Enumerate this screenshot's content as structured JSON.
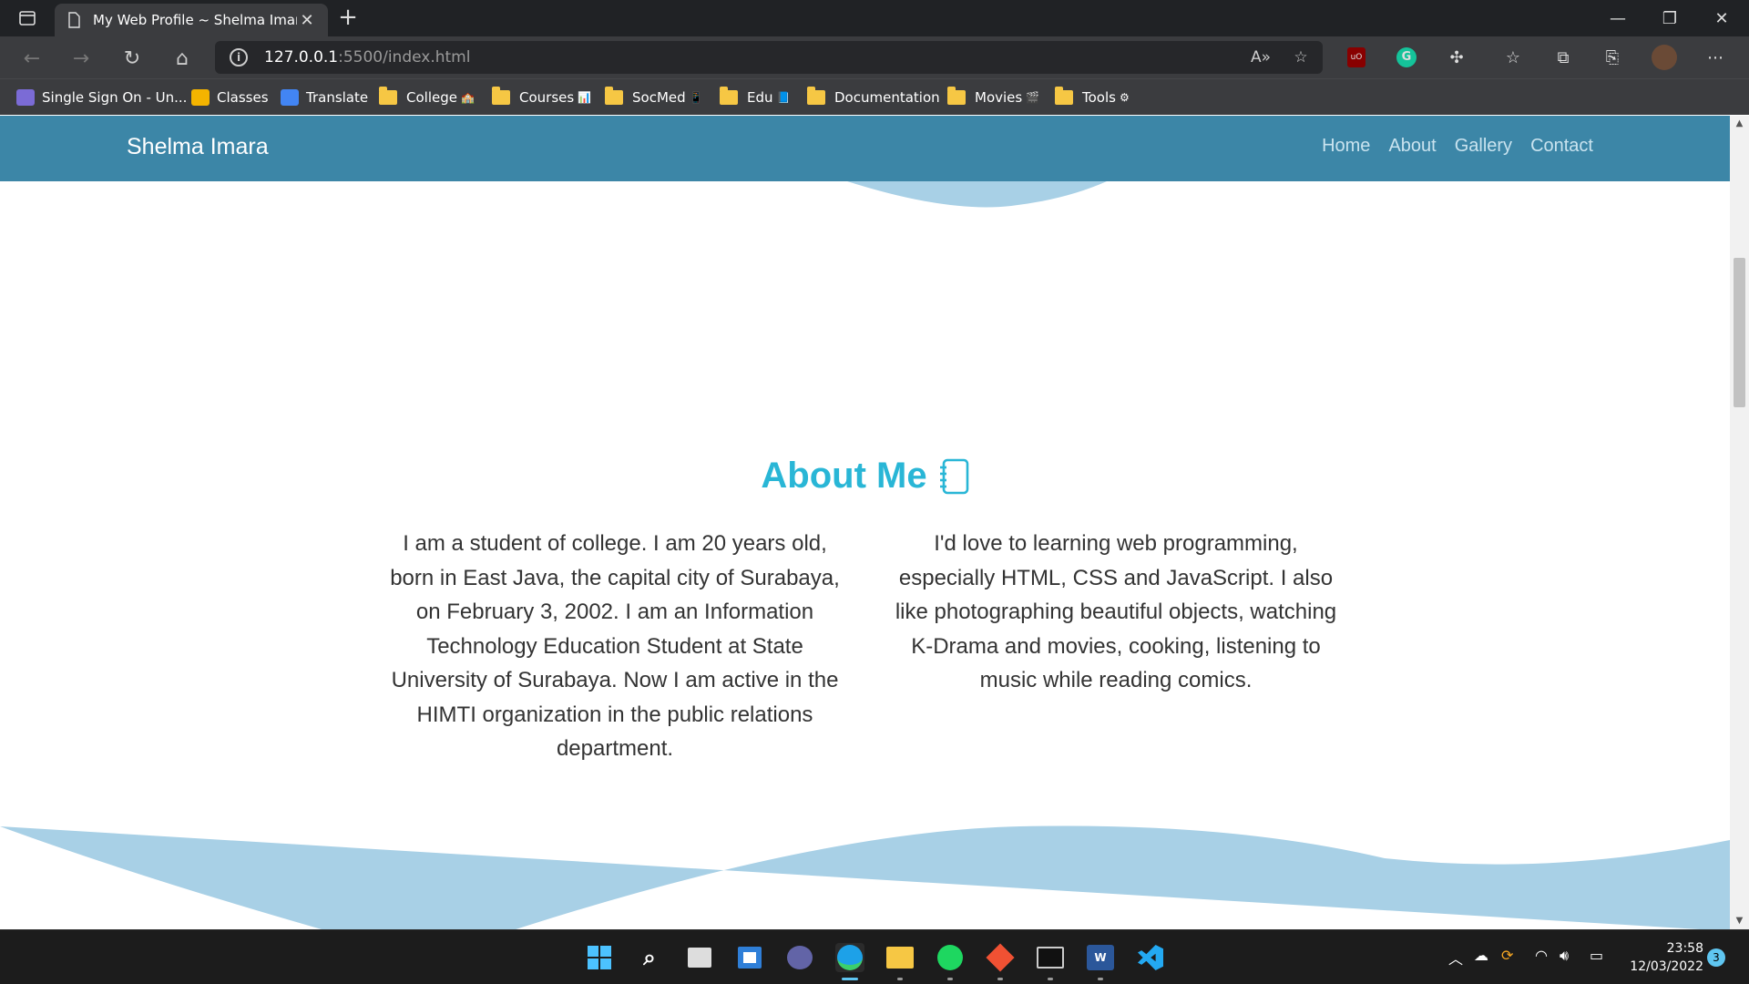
{
  "browser": {
    "tab_title": "My Web Profile ~ Shelma Imara",
    "url_host": "127.0.0.1",
    "url_rest": ":5500/index.html",
    "bookmarks": [
      {
        "label": "Single Sign On - Un...",
        "type": "site"
      },
      {
        "label": "Classes",
        "type": "site"
      },
      {
        "label": "Translate",
        "type": "site"
      },
      {
        "label": "College",
        "type": "folder",
        "emoji": "🏫"
      },
      {
        "label": "Courses",
        "type": "folder",
        "emoji": "📊"
      },
      {
        "label": "SocMed",
        "type": "folder",
        "emoji": "📱"
      },
      {
        "label": "Edu",
        "type": "folder",
        "emoji": "📘"
      },
      {
        "label": "Documentation",
        "type": "folder",
        "emoji": ""
      },
      {
        "label": "Movies",
        "type": "folder",
        "emoji": "🎬"
      },
      {
        "label": "Tools",
        "type": "folder",
        "emoji": "⚙"
      }
    ]
  },
  "site": {
    "brand": "Shelma Imara",
    "nav": [
      "Home",
      "About",
      "Gallery",
      "Contact"
    ],
    "about_title": "About Me",
    "about_left": "I am a student of college. I am 20 years old, born in East Java, the capital city of Surabaya, on February 3, 2002. I am an Information Technology Education Student at State University of Surabaya. Now I am active in the HIMTI organization in the public relations department.",
    "about_right": "I'd love to learning web programming, especially HTML, CSS and JavaScript. I also like photographing beautiful objects, watching K-Drama and movies, cooking, listening to music while reading comics.",
    "colors": {
      "nav": "#3c86a7",
      "wave": "#a8d0e6",
      "accent": "#29b6d6"
    }
  },
  "taskbar": {
    "time": "23:58",
    "date": "12/03/2022",
    "notifications": "3",
    "apps": [
      "start-icon",
      "search-icon",
      "task-view-icon",
      "widgets-icon",
      "teams-chat-icon",
      "edge-icon",
      "file-explorer-icon",
      "spotify-icon",
      "git-icon",
      "terminal-icon",
      "word-icon",
      "vscode-icon"
    ]
  }
}
